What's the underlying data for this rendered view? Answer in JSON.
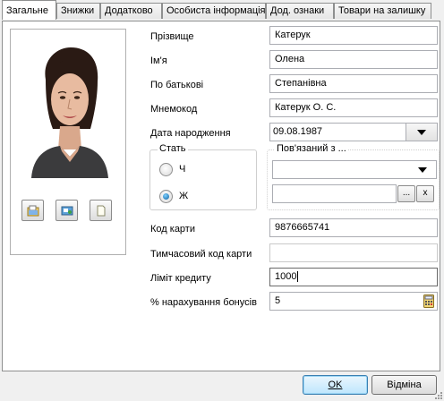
{
  "tabs": [
    {
      "label": "Загальне",
      "active": true
    },
    {
      "label": "Знижки"
    },
    {
      "label": "Додатково"
    },
    {
      "label": "Особиста інформація"
    },
    {
      "label": "Дод. ознаки"
    },
    {
      "label": "Товари на залишку"
    }
  ],
  "photo": {
    "buttons": [
      "open-image-icon",
      "scan-image-icon",
      "blank-page-icon"
    ]
  },
  "form": {
    "surname_label": "Прізвище",
    "surname_value": "Катерук",
    "name_label": "Ім'я",
    "name_value": "Олена",
    "patronymic_label": "По батькові",
    "patronymic_value": "Степанівна",
    "mnemocode_label": "Мнемокод",
    "mnemocode_value": "Катерук О. С.",
    "birthdate_label": "Дата народження",
    "birthdate_value": "09.08.1987",
    "gender_title": "Стать",
    "gender_options": [
      {
        "label": "Ч",
        "checked": false
      },
      {
        "label": "Ж",
        "checked": true
      }
    ],
    "related_title": "Пов'язаний з ...",
    "related_select_value": "",
    "related_text_value": "",
    "related_browse_label": "...",
    "related_clear_label": "x",
    "card_code_label": "Код карти",
    "card_code_value": "9876665741",
    "temp_card_label": "Тимчасовий код карти",
    "temp_card_value": "",
    "credit_limit_label": "Ліміт кредиту",
    "credit_limit_value": "1000",
    "bonus_label": "% нарахування бонусів",
    "bonus_value": "5"
  },
  "buttons": {
    "ok_label": "OK",
    "cancel_label": "Відміна"
  },
  "colors": {
    "accent": "#3c7fb1",
    "radio_checked": "#0a5f9e"
  }
}
